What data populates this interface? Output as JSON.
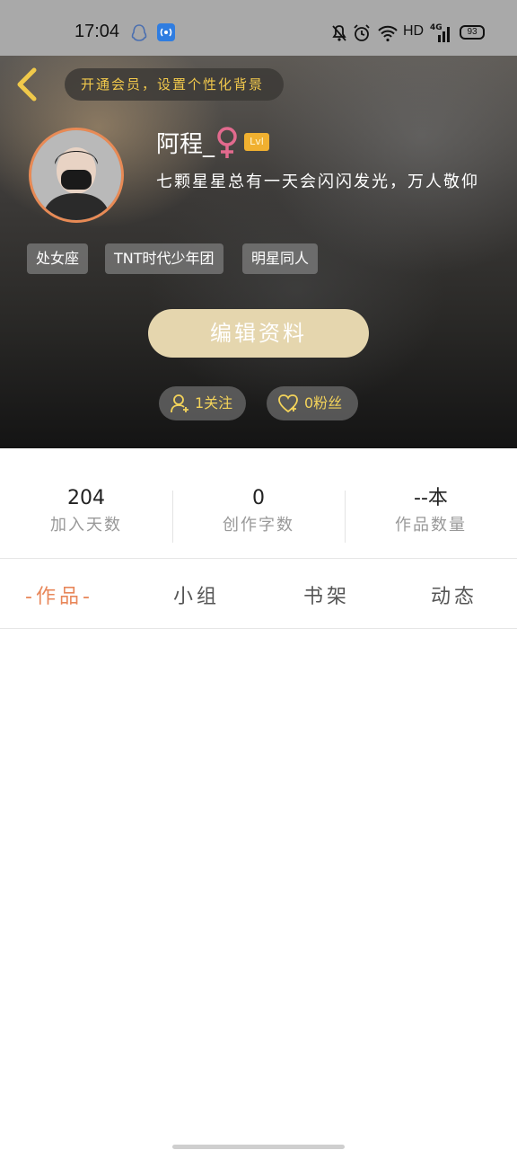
{
  "status_bar": {
    "time": "17:04",
    "network": "HD",
    "signal_label": "4G",
    "battery": "93",
    "icons": [
      "qq-icon",
      "hotspot-icon",
      "bell-off-icon",
      "alarm-icon",
      "wifi-icon",
      "signal-icon",
      "battery-icon"
    ]
  },
  "header": {
    "back_icon": "chevron-left-icon",
    "vip_banner": "开通会员，设置个性化背景",
    "username": "阿程_",
    "gender_icon": "female-icon",
    "level": "Lvl",
    "signature": "七颗星星总有一天会闪闪发光，万人敬仰",
    "tags": [
      "处女座",
      "TNT时代少年团",
      "明星同人"
    ],
    "edit_button": "编辑资料",
    "following": "1关注",
    "fans": "0粉丝",
    "colors": {
      "accent_yellow": "#f3d35a",
      "edit_button_bg": "#e5d6ae",
      "avatar_border": "#e88a55"
    }
  },
  "stats": [
    {
      "value": "204",
      "label": "加入天数"
    },
    {
      "value": "0",
      "label": "创作字数"
    },
    {
      "value": "--本",
      "label": "作品数量"
    }
  ],
  "tabs": [
    {
      "label": "-作品-",
      "active": true
    },
    {
      "label": "小组",
      "active": false
    },
    {
      "label": "书架",
      "active": false
    },
    {
      "label": "动态",
      "active": false
    }
  ],
  "colors": {
    "active_tab": "#e8875a"
  }
}
